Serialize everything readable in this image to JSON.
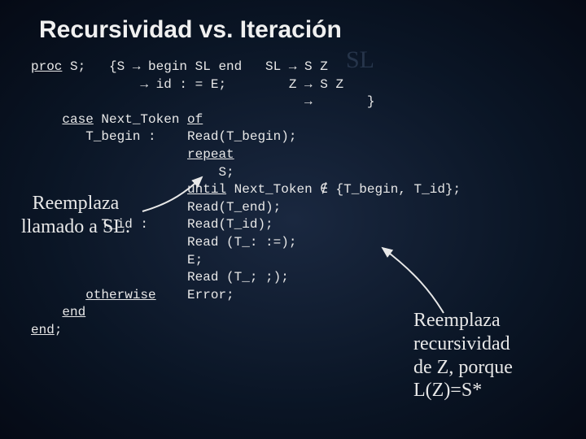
{
  "title": "Recursividad vs. Iteración",
  "ghost": "SL",
  "proc_line": "proc",
  "proc_rest": " S;   {S → begin SL end   SL → S Z",
  "line2": "              → id : = E;        Z → S Z",
  "line3": "                                   →       }",
  "case_kw": "case",
  "case_rest": " Next_Token ",
  "of_kw": "of",
  "tbegin_label": "       T_begin :    Read(T_begin);",
  "repeat_pad": "                    ",
  "repeat_kw": "repeat",
  "s_call": "                        S;",
  "until_pad": "                    ",
  "until_kw": "until",
  "until_rest": " Next_Token ∉ {T_begin, T_id};",
  "read_tend": "                    Read(T_end);",
  "tid_label": "         T_id :     Read(T_id);",
  "read_assign": "                    Read (T_: :=);",
  "e_call": "                    E;",
  "read_semi": "                    Read (T_; ;);",
  "otherwise_pad": "       ",
  "otherwise_kw": "otherwise",
  "otherwise_rest": "    Error;",
  "end_pad1": "    ",
  "end_kw1": "end",
  "end_pad2": "",
  "end_kw2": "end",
  "end_semi": ";",
  "annotation_left_l1": "Reemplaza",
  "annotation_left_l2": "llamado a SL.",
  "annotation_right_l1": "Reemplaza",
  "annotation_right_l2": "recursividad",
  "annotation_right_l3": "de Z, porque",
  "annotation_right_l4": "L(Z)=S*"
}
